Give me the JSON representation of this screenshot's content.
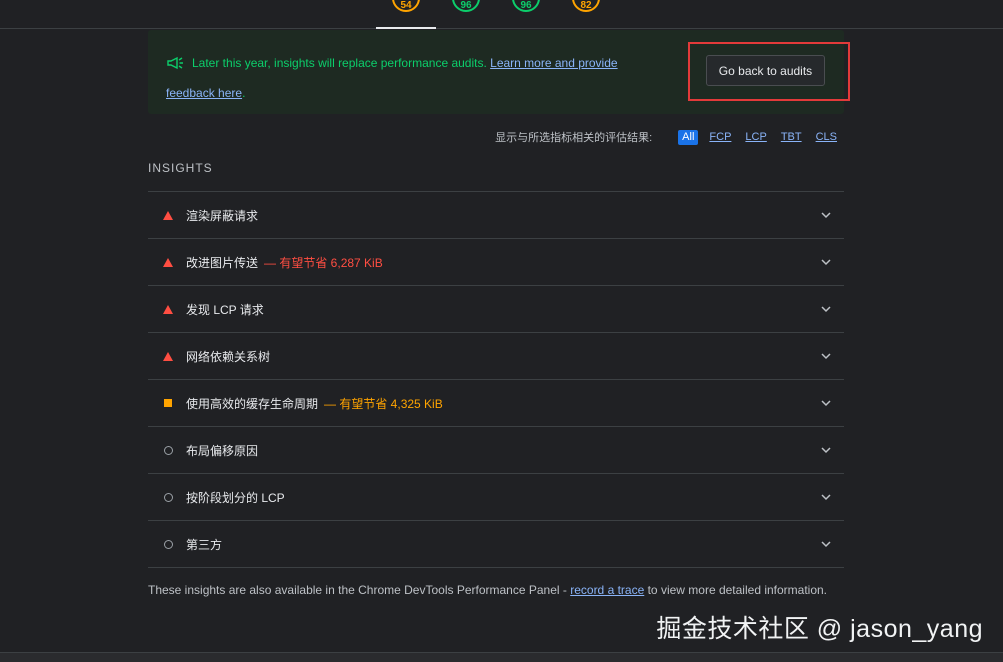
{
  "scores": [
    {
      "value": "54",
      "color": "#ffa400"
    },
    {
      "value": "96",
      "color": "#0cce6b"
    },
    {
      "value": "96",
      "color": "#0cce6b"
    },
    {
      "value": "82",
      "color": "#ffa400"
    }
  ],
  "notice": {
    "text": "Later this year, insights will replace performance audits.",
    "link_text_1": "Learn more and provide",
    "link_text_2": "feedback here",
    "period": ".",
    "button_label": "Go back to audits",
    "icon": "megaphone-icon"
  },
  "filter": {
    "label": "显示与所选指标相关的评估结果:",
    "chips": [
      "All",
      "FCP",
      "LCP",
      "TBT",
      "CLS"
    ],
    "active": "All"
  },
  "insights_heading": "INSIGHTS",
  "insights": [
    {
      "title": "渲染屏蔽请求",
      "severity": "fail",
      "savings": ""
    },
    {
      "title": "改进图片传送",
      "severity": "fail",
      "savings": "— 有望节省 6,287 KiB"
    },
    {
      "title": "发现 LCP 请求",
      "severity": "fail",
      "savings": ""
    },
    {
      "title": "网络依赖关系树",
      "severity": "fail",
      "savings": ""
    },
    {
      "title": "使用高效的缓存生命周期",
      "severity": "average",
      "savings": "— 有望节省 4,325 KiB"
    },
    {
      "title": "布局偏移原因",
      "severity": "info",
      "savings": ""
    },
    {
      "title": "按阶段划分的 LCP",
      "severity": "info",
      "savings": ""
    },
    {
      "title": "第三方",
      "severity": "info",
      "savings": ""
    }
  ],
  "footer": {
    "text_before": "These insights are also available in the Chrome DevTools Performance Panel - ",
    "link": "record a trace",
    "text_after": " to view more detailed information."
  },
  "watermark": "掘金技术社区 @ jason_yang",
  "colors": {
    "fail": "#ff4e42",
    "average": "#ffa400",
    "pass": "#0cce6b",
    "link": "#8ab4f8",
    "accent": "#1a73e8"
  }
}
